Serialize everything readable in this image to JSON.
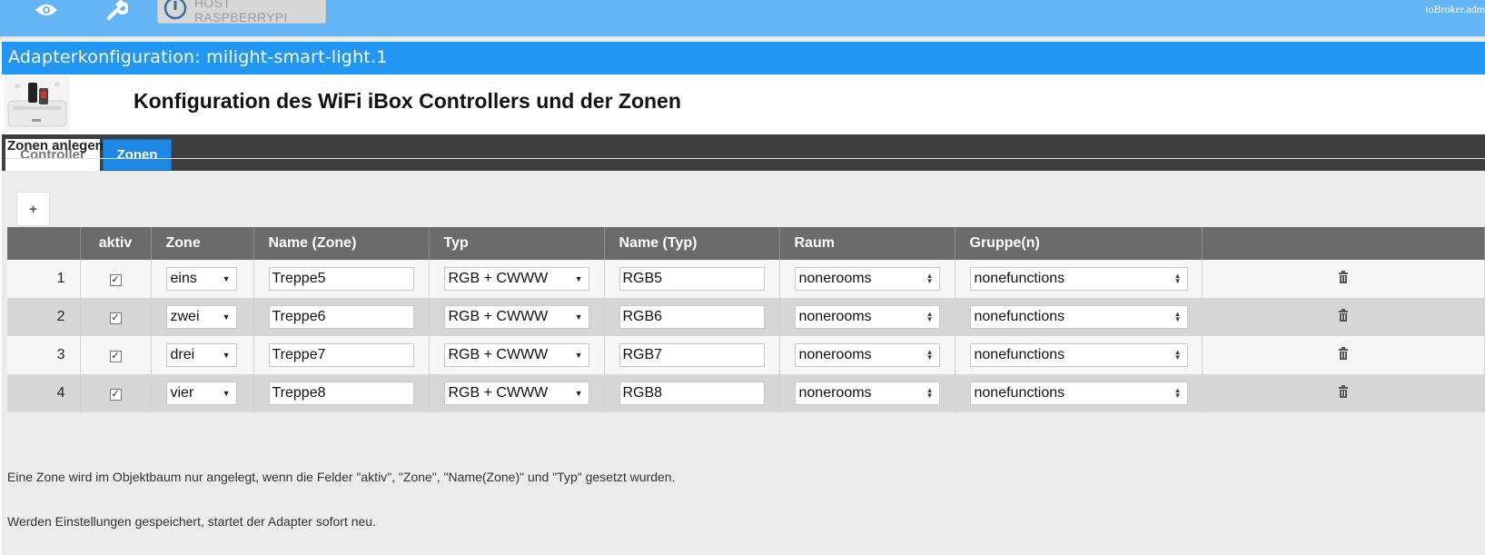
{
  "topbar": {
    "host_label": "HOST RASPBERRYPI",
    "right_text": "ioBroker.adm",
    "icons": [
      "eye-icon",
      "wrench-icon",
      "power-icon"
    ]
  },
  "dialog": {
    "title": "Adapterkonfiguration: milight-smart-light.1",
    "page_title": "Konfiguration des WiFi iBox Controllers und der Zonen"
  },
  "tabs": [
    {
      "label": "Controller",
      "active": false
    },
    {
      "label": "Zonen",
      "active": true
    }
  ],
  "section": {
    "title": "Zonen anlegen",
    "add_label": "+"
  },
  "table": {
    "headers": [
      "",
      "aktiv",
      "Zone",
      "Name (Zone)",
      "Typ",
      "Name (Typ)",
      "Raum",
      "Gruppe(n)",
      ""
    ],
    "rows": [
      {
        "num": "1",
        "aktiv": true,
        "zone": "eins",
        "name_zone": "Treppe5",
        "typ": "RGB + CWWW",
        "name_typ": "RGB5",
        "raum": "nonerooms",
        "gruppe": "nonefunctions"
      },
      {
        "num": "2",
        "aktiv": true,
        "zone": "zwei",
        "name_zone": "Treppe6",
        "typ": "RGB + CWWW",
        "name_typ": "RGB6",
        "raum": "nonerooms",
        "gruppe": "nonefunctions"
      },
      {
        "num": "3",
        "aktiv": true,
        "zone": "drei",
        "name_zone": "Treppe7",
        "typ": "RGB + CWWW",
        "name_typ": "RGB7",
        "raum": "nonerooms",
        "gruppe": "nonefunctions"
      },
      {
        "num": "4",
        "aktiv": true,
        "zone": "vier",
        "name_zone": "Treppe8",
        "typ": "RGB + CWWW",
        "name_typ": "RGB8",
        "raum": "nonerooms",
        "gruppe": "nonefunctions"
      }
    ]
  },
  "notes": [
    "Eine Zone wird im Objektbaum nur angelegt, wenn die Felder \"aktiv\", \"Zone\", \"Name(Zone)\" und \"Typ\" gesetzt wurden.",
    "Werden Einstellungen gespeichert, startet der Adapter sofort neu."
  ],
  "colors": {
    "topbar": "#64b5f6",
    "dialog_title": "#2196f3",
    "active_tab": "#1e88e5",
    "tabbar": "#3f3f3f",
    "table_header": "#6b6b6b"
  }
}
